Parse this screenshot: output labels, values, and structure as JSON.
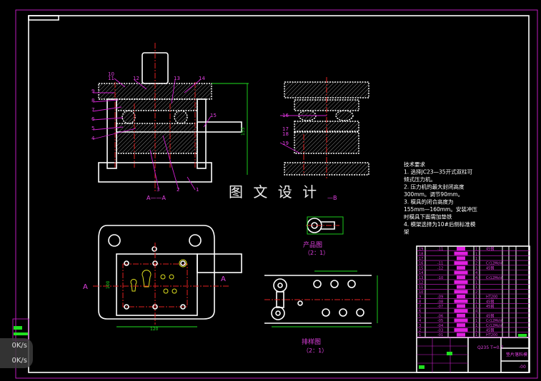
{
  "watermark": "图 文 设 计",
  "main_view": {
    "section_label": "A——A",
    "part_labels": [
      "1",
      "2",
      "3",
      "4",
      "5",
      "6",
      "7",
      "8",
      "9",
      "10",
      "11",
      "12",
      "13",
      "14",
      "15"
    ],
    "height_dim": "153"
  },
  "side_view": {
    "section_label": "—B",
    "part_labels": [
      "16",
      "17",
      "18",
      "19"
    ]
  },
  "plan_view": {
    "label_left": "A",
    "label_right": "A",
    "dim_bottom": "120",
    "dim_left": "100"
  },
  "product_drawing": {
    "title": "产品图",
    "scale": "（2：1）"
  },
  "strip_layout": {
    "title": "排样图",
    "scale": "（2：1）"
  },
  "tech_requirements": [
    "技术要求",
    "1. 选择JC23—35开式双柱可",
    "倾式压力机。",
    "2. 压力机的最大封闭高度",
    "300mm。调节90mm。",
    "3. 模具的闭合高度为",
    "155mm—160mm。安装冲压",
    "时模具下面需加垫铁",
    "4. 模架选择为10#后侧标准模",
    "架"
  ],
  "title_block": {
    "part_numbers": [
      "19",
      "18",
      "17",
      "16",
      "15",
      "14",
      "13",
      "12",
      "11",
      "10",
      "9",
      "8",
      "7",
      "6",
      "5",
      "4",
      "3",
      "2",
      "1"
    ],
    "codes": [
      "-11",
      "",
      "",
      "-11",
      "-12",
      "",
      "-10",
      "",
      "",
      "",
      "-09",
      "-08",
      "-07",
      "",
      "-06",
      "-05",
      "-04",
      "-03",
      "-01"
    ],
    "quantities": [
      "1",
      "1",
      "1",
      "2",
      "1",
      "4",
      "4",
      "1",
      "1",
      "2",
      "1",
      "1",
      "1",
      "4",
      "1",
      "1",
      "1",
      "1",
      "1"
    ],
    "materials": [
      "45钢",
      "",
      "",
      "Cr12MoV",
      "45钢",
      "",
      "Cr12MoV",
      "",
      "",
      "",
      "HT200",
      "45钢",
      "45钢",
      "",
      "45钢",
      "Cr12MoV",
      "Cr12MoV",
      "45钢",
      "HT200"
    ],
    "material_spec": "Q235  T=0.7",
    "drawing_name": "垫片落料模",
    "drawing_number": "-00"
  },
  "network_speed": {
    "upload": "0K/s",
    "download": "0K/s"
  }
}
